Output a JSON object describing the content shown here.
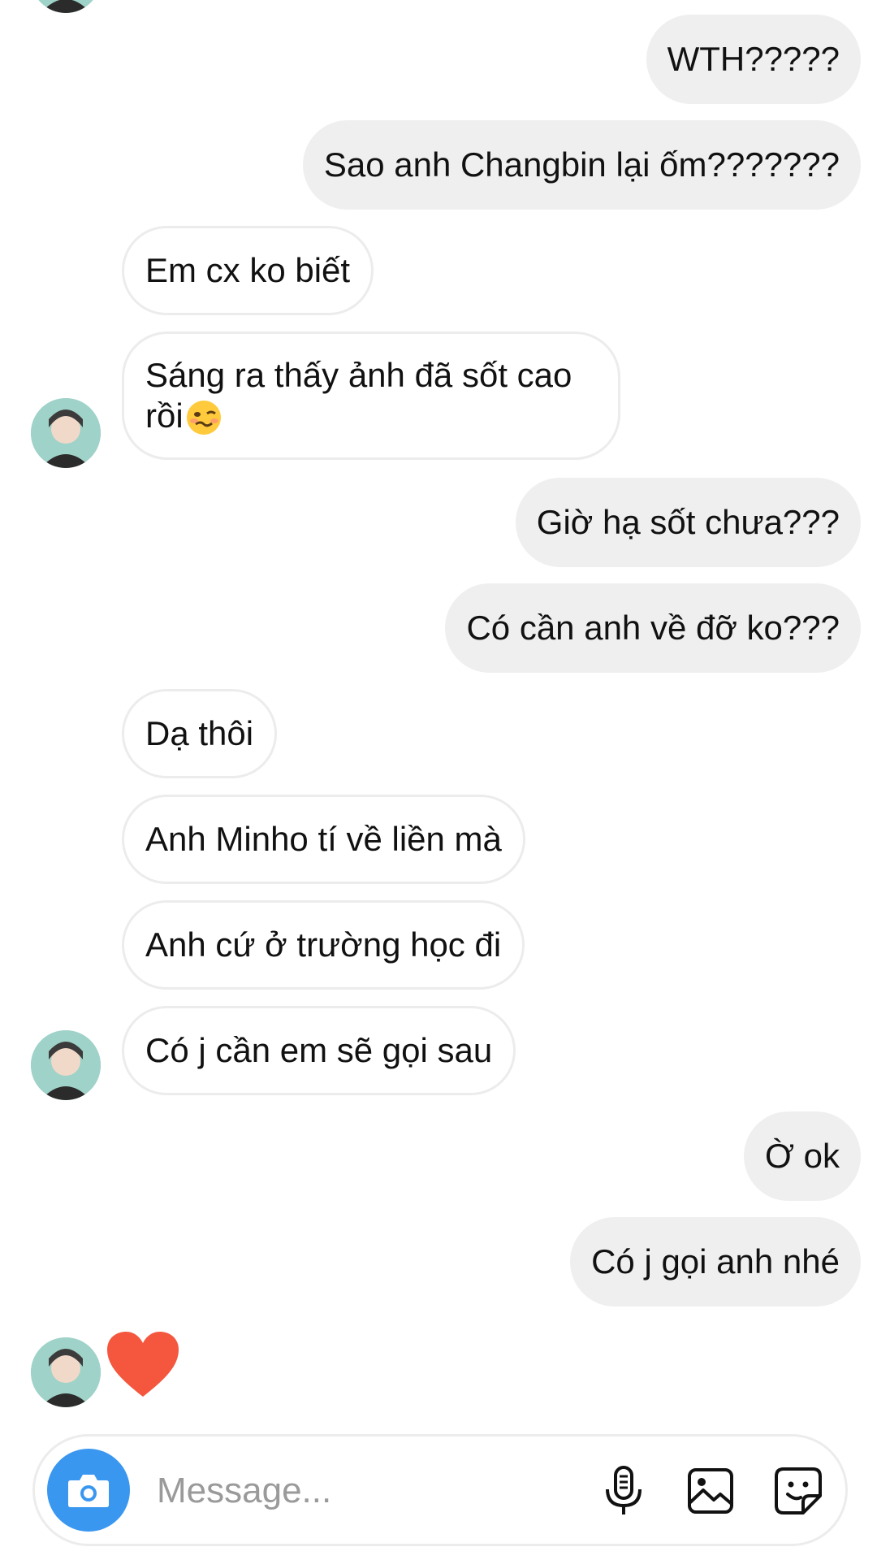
{
  "messages": [
    {
      "text": "WTH?????"
    },
    {
      "text": "Sao anh Changbin lại ốm???????"
    },
    {
      "text": "Em cx ko biết"
    },
    {
      "text": "Sáng ra thấy ảnh đã sốt cao rồi",
      "emoji": "woozy-face"
    },
    {
      "text": "Giờ hạ sốt chưa???"
    },
    {
      "text": "Có cần anh về đỡ ko???"
    },
    {
      "text": "Dạ thôi"
    },
    {
      "text": "Anh Minho tí về liền mà"
    },
    {
      "text": "Anh cứ ở trường học đi"
    },
    {
      "text": "Có j cần em sẽ gọi sau"
    },
    {
      "text": "Ờ ok"
    },
    {
      "text": "Có j gọi anh nhé"
    }
  ],
  "reaction": {
    "icon": "heart-icon",
    "color": "#f4573e"
  },
  "composer": {
    "placeholder": "Message...",
    "camera_icon": "camera-icon",
    "mic_icon": "microphone-icon",
    "gallery_icon": "gallery-icon",
    "sticker_icon": "sticker-icon",
    "accent": "#3a97f0"
  },
  "colors": {
    "outgoing_bubble": "#efefef",
    "incoming_border": "#ececec"
  }
}
